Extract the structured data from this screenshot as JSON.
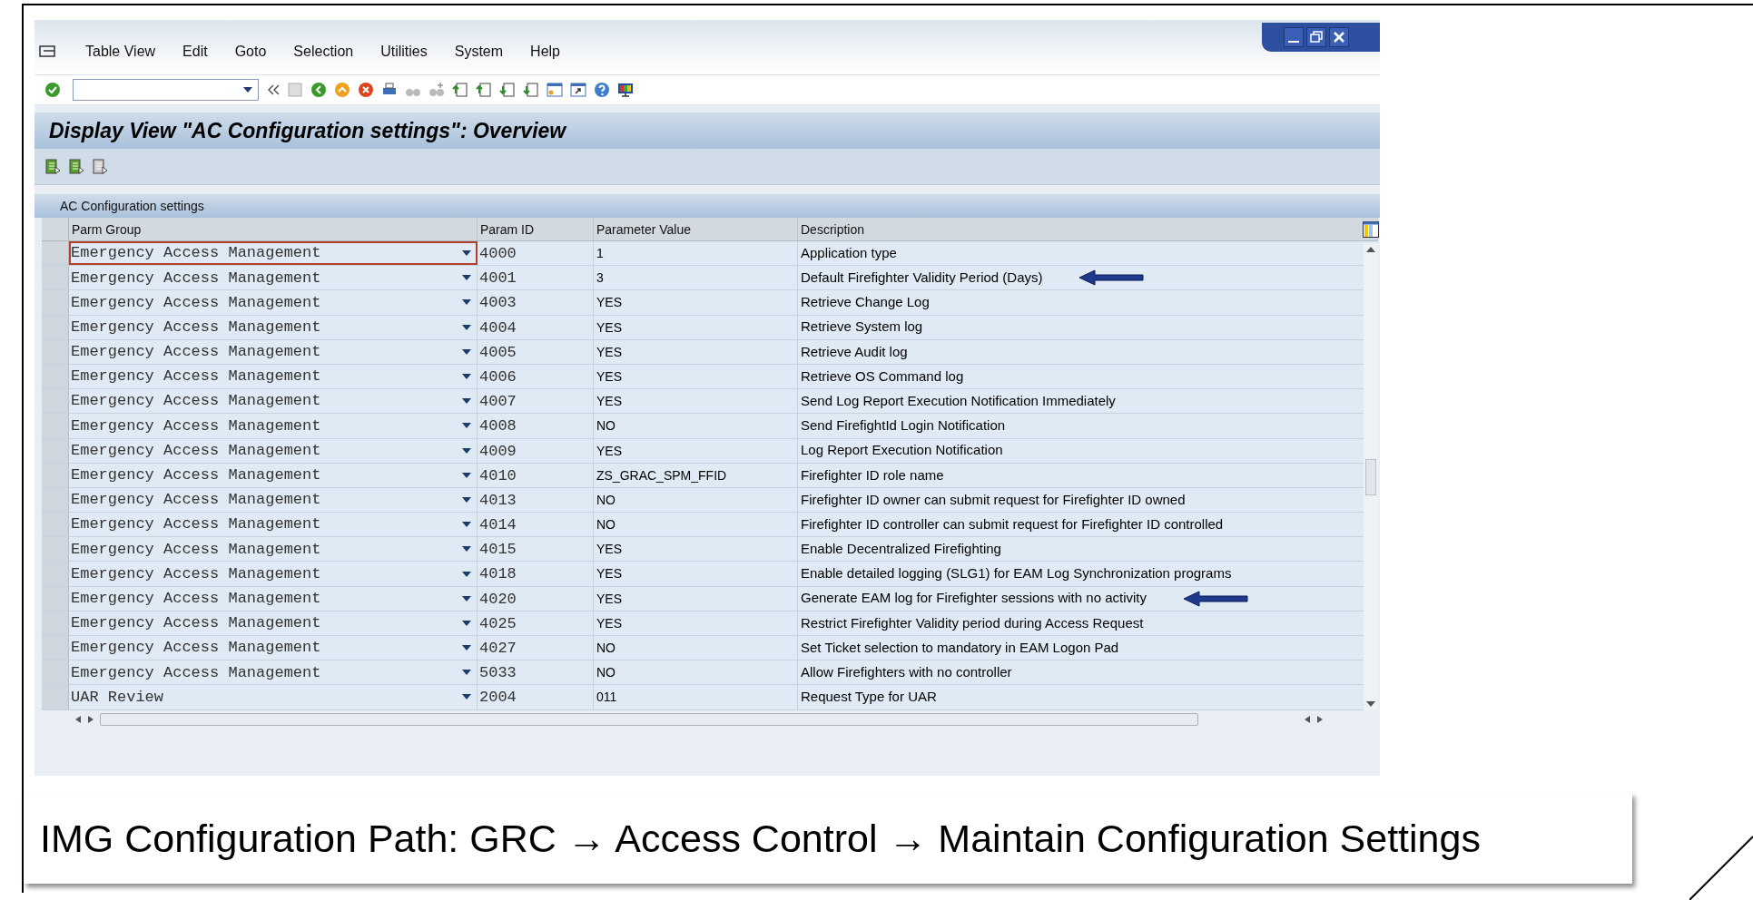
{
  "menu": [
    "Table View",
    "Edit",
    "Goto",
    "Selection",
    "Utilities",
    "System",
    "Help"
  ],
  "title": "Display View \"AC Configuration settings\": Overview",
  "section_title": "AC Configuration settings",
  "columns": [
    "Parm Group",
    "Param ID",
    "Parameter Value",
    "Description"
  ],
  "rows": [
    {
      "group": "Emergency Access Management",
      "id": "4000",
      "value": "1",
      "description": "Application type",
      "focused": true,
      "arrow": false
    },
    {
      "group": "Emergency Access Management",
      "id": "4001",
      "value": "3",
      "description": "Default Firefighter Validity Period (Days)",
      "focused": false,
      "arrow": true
    },
    {
      "group": "Emergency Access Management",
      "id": "4003",
      "value": "YES",
      "description": "Retrieve Change Log",
      "focused": false,
      "arrow": false
    },
    {
      "group": "Emergency Access Management",
      "id": "4004",
      "value": "YES",
      "description": "Retrieve System log",
      "focused": false,
      "arrow": false
    },
    {
      "group": "Emergency Access Management",
      "id": "4005",
      "value": "YES",
      "description": "Retrieve Audit log",
      "focused": false,
      "arrow": false
    },
    {
      "group": "Emergency Access Management",
      "id": "4006",
      "value": "YES",
      "description": "Retrieve OS Command log",
      "focused": false,
      "arrow": false
    },
    {
      "group": "Emergency Access Management",
      "id": "4007",
      "value": "YES",
      "description": "Send Log Report Execution Notification Immediately",
      "focused": false,
      "arrow": false
    },
    {
      "group": "Emergency Access Management",
      "id": "4008",
      "value": "NO",
      "description": "Send FirefightId Login Notification",
      "focused": false,
      "arrow": false
    },
    {
      "group": "Emergency Access Management",
      "id": "4009",
      "value": "YES",
      "description": "Log Report Execution Notification",
      "focused": false,
      "arrow": false
    },
    {
      "group": "Emergency Access Management",
      "id": "4010",
      "value": "ZS_GRAC_SPM_FFID",
      "description": "Firefighter ID role name",
      "focused": false,
      "arrow": false
    },
    {
      "group": "Emergency Access Management",
      "id": "4013",
      "value": "NO",
      "description": "Firefighter ID owner can submit request for Firefighter ID owned",
      "focused": false,
      "arrow": false
    },
    {
      "group": "Emergency Access Management",
      "id": "4014",
      "value": "NO",
      "description": "Firefighter ID controller can submit request for Firefighter ID controlled",
      "focused": false,
      "arrow": false
    },
    {
      "group": "Emergency Access Management",
      "id": "4015",
      "value": "YES",
      "description": "Enable Decentralized Firefighting",
      "focused": false,
      "arrow": false
    },
    {
      "group": "Emergency Access Management",
      "id": "4018",
      "value": "YES",
      "description": "Enable detailed logging (SLG1) for EAM Log Synchronization programs",
      "focused": false,
      "arrow": false
    },
    {
      "group": "Emergency Access Management",
      "id": "4020",
      "value": "YES",
      "description": "Generate EAM log for Firefighter sessions with no activity",
      "focused": false,
      "arrow": true
    },
    {
      "group": "Emergency Access Management",
      "id": "4025",
      "value": "YES",
      "description": "Restrict Firefighter Validity period during Access Request",
      "focused": false,
      "arrow": false
    },
    {
      "group": "Emergency Access Management",
      "id": "4027",
      "value": "NO",
      "description": "Set Ticket selection to mandatory in EAM Logon Pad",
      "focused": false,
      "arrow": false
    },
    {
      "group": "Emergency Access Management",
      "id": "5033",
      "value": "NO",
      "description": "Allow Firefighters with no controller",
      "focused": false,
      "arrow": false
    },
    {
      "group": "UAR Review",
      "id": "2004",
      "value": "011",
      "description": "Request Type for UAR",
      "focused": false,
      "arrow": false
    }
  ],
  "caption": "IMG Configuration Path: GRC → Access Control → Maintain Configuration Settings"
}
